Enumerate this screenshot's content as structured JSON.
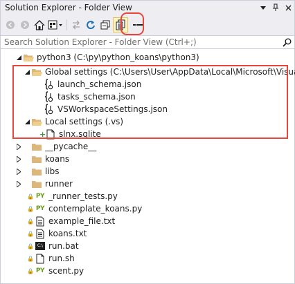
{
  "window": {
    "title": "Solution Explorer - Folder View"
  },
  "search": {
    "placeholder": "Search Solution Explorer - Folder View (Ctrl+;)"
  },
  "tree": {
    "root": "python3 (C:\\py\\python_koans\\python3)",
    "global_settings": {
      "label": "Global settings (C:\\Users\\User\\AppData\\Local\\Microsoft\\VisualSt",
      "files": [
        "launch_schema.json",
        "tasks_schema.json",
        "VSWorkspaceSettings.json"
      ]
    },
    "local_settings": {
      "label": "Local settings (.vs)",
      "files": [
        "slnx.sqlite"
      ]
    },
    "folders": [
      "__pycache__",
      "koans",
      "libs",
      "runner"
    ],
    "files": [
      "_runner_tests.py",
      "contemplate_koans.py",
      "example_file.txt",
      "koans.txt",
      "run.bat",
      "run.sh",
      "scent.py"
    ]
  },
  "icons": {
    "py_badge": "PY",
    "bat_badge": "C:\\"
  },
  "colors": {
    "highlight_border": "#e8453c",
    "folder": "#dcb67a",
    "python_green": "#6b9c22"
  }
}
